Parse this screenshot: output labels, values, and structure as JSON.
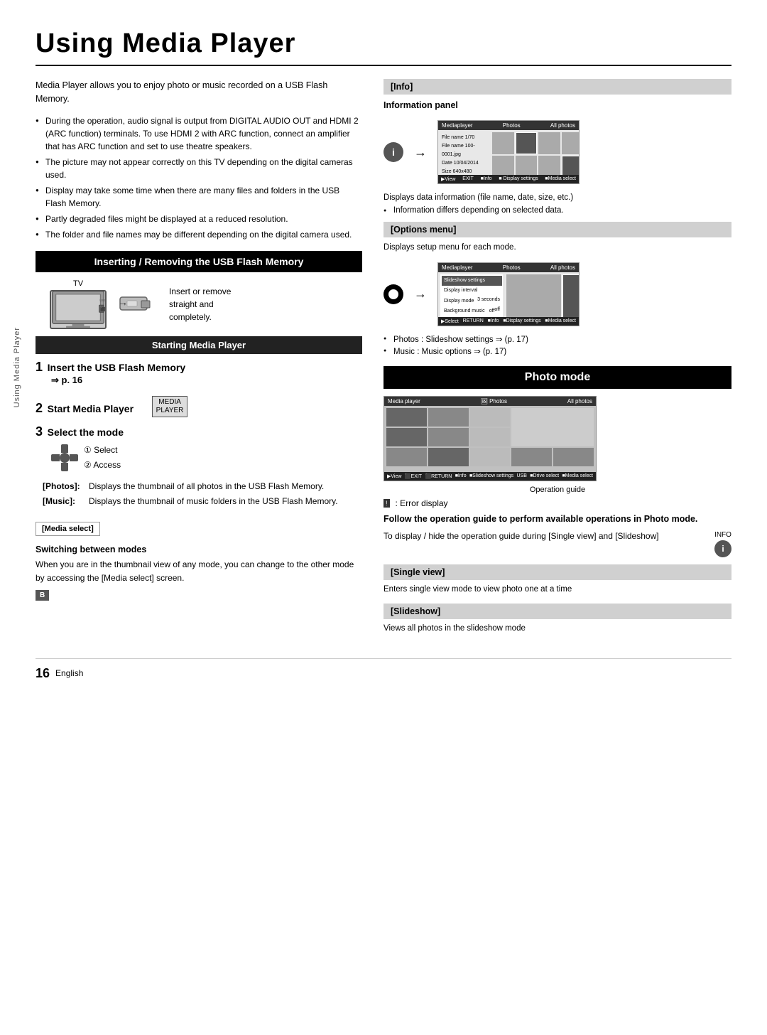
{
  "page": {
    "title": "Using Media Player",
    "page_number": "16",
    "language": "English"
  },
  "sidebar_label": "Using Media Player",
  "intro": {
    "text": "Media Player allows you to enjoy photo or music recorded on a USB Flash Memory.",
    "bullets": [
      "During the operation, audio signal is output from DIGITAL AUDIO OUT and HDMI 2 (ARC function) terminals. To use HDMI 2 with ARC function, connect an amplifier that has ARC function and set to use theatre speakers.",
      "The picture may not appear correctly on this TV depending on the digital cameras used.",
      "Display may take some time when there are many files and folders in the USB Flash Memory.",
      "Partly degraded files might be displayed at a reduced resolution.",
      "The folder and file names may be different depending on the digital camera used."
    ]
  },
  "inserting_section": {
    "header": "Inserting / Removing the USB Flash Memory",
    "tv_label": "TV",
    "insert_text_line1": "Insert or remove",
    "insert_text_line2": "straight and",
    "insert_text_line3": "completely."
  },
  "starting_section": {
    "header": "Starting Media Player",
    "steps": [
      {
        "num": "1",
        "title": "Insert the USB Flash Memory",
        "sub": "⇒ p. 16"
      },
      {
        "num": "2",
        "title": "Start Media Player"
      },
      {
        "num": "3",
        "title": "Select the mode",
        "select_label": "① Select",
        "access_label": "② Access"
      }
    ],
    "modes": [
      {
        "label": "[Photos]:",
        "desc": "Displays the thumbnail of all photos in the USB Flash Memory."
      },
      {
        "label": "[Music]:",
        "desc": "Displays the thumbnail of music folders in the USB Flash Memory."
      }
    ]
  },
  "media_select": {
    "header": "[Media select]",
    "subheader": "Switching between modes",
    "body": "When you are in the thumbnail view of any mode, you can change to the other mode by accessing the [Media select] screen."
  },
  "right_col": {
    "info_section": {
      "header": "[Info]",
      "subheader": "Information panel",
      "screen_header_left": "Mediaplayer",
      "screen_header_mid": "Photos",
      "screen_header_right": "All photos",
      "sidebar_items": [
        "File name  1/70",
        "File name  100-0001.jpg",
        "Date  10/04/2014",
        "Size  640x480"
      ],
      "desc1": "Displays data information (file name, date, size, etc.)",
      "bullet1": "Information differs depending on selected data."
    },
    "options_section": {
      "header": "[Options menu]",
      "desc": "Displays setup menu for each mode.",
      "bullet1": "Photos : Slideshow settings ⇒ (p. 17)",
      "bullet2": "Music : Music options ⇒ (p. 17)"
    },
    "photo_mode": {
      "header": "Photo mode",
      "op_guide": "Operation guide",
      "error_label": ": Error display",
      "bold_text": "Follow the operation guide to perform available operations in Photo mode.",
      "to_display_text": "To display / hide the operation guide during [Single view] and [Slideshow]",
      "info_label": "INFO"
    },
    "single_view": {
      "header": "[Single view]",
      "desc": "Enters single view mode to view photo one at a time"
    },
    "slideshow": {
      "header": "[Slideshow]",
      "desc": "Views all photos in the slideshow mode"
    }
  }
}
